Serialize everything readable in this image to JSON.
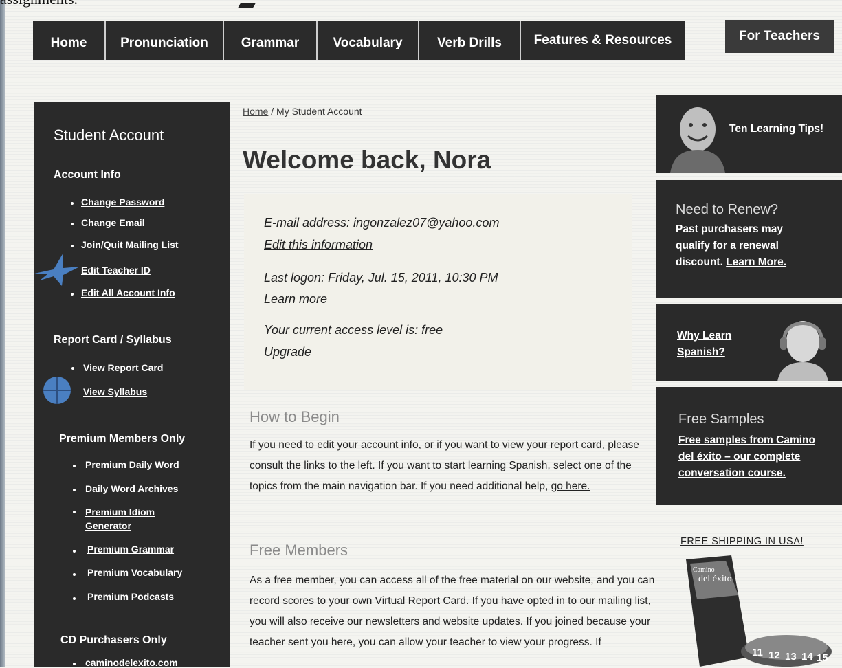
{
  "top_fragment": "assignments.",
  "nav": {
    "items": [
      "Home",
      "Pronunciation",
      "Grammar",
      "Vocabulary",
      "Verb Drills",
      "Features & Resources"
    ],
    "teachers": "For Teachers"
  },
  "sidebar": {
    "title": "Student Account",
    "account_info": {
      "heading": "Account Info",
      "links": [
        "Change Password",
        "Change Email",
        "Join/Quit Mailing List",
        "Edit Teacher ID",
        "Edit All Account Info"
      ]
    },
    "report_card": {
      "heading": "Report Card / Syllabus",
      "links": [
        "View Report Card",
        "View Syllabus"
      ]
    },
    "premium": {
      "heading": "Premium Members Only",
      "links": [
        "Premium Daily Word",
        "Daily Word Archives",
        "Premium Idiom Generator",
        "Premium Grammar",
        "Premium Vocabulary",
        "Premium Podcasts"
      ]
    },
    "cd": {
      "heading": "CD Purchasers Only",
      "links": [
        "caminodelexito.com"
      ]
    }
  },
  "breadcrumb": {
    "home": "Home",
    "separator": " / ",
    "current": "My Student Account"
  },
  "welcome": "Welcome back, Nora",
  "info": {
    "email": "E-mail address: ingonzalez07@yahoo.com",
    "edit": "Edit this information",
    "logon": "Last logon: Friday, Jul. 15, 2011, 10:30 PM",
    "learn_more": "Learn more",
    "access": "Your current access level is: free",
    "upgrade": "Upgrade"
  },
  "how_to_begin": {
    "heading": "How to Begin",
    "text": "If you need to edit your account info, or if you want to view your report card, please consult the links to the left. If you want to start learning Spanish, select one of the topics from the main navigation bar. If you need additional help, ",
    "link": "go here."
  },
  "free_members": {
    "heading": "Free Members",
    "text": "As a free member, you can access all of the free material on our website, and you can record scores to your own Virtual Report Card. If you have opted in to our mailing list, you will also receive our newsletters and website updates. If you joined because your teacher sent you here, you can allow your teacher to view your progress. If"
  },
  "right": {
    "tips": "Ten Learning Tips!",
    "renew_title": "Need to Renew?",
    "renew_text": "Past purchasers may qualify for a renewal discount. ",
    "renew_link": "Learn More.",
    "why": "Why Learn Spanish?",
    "samples_title": "Free Samples",
    "samples_link": "Free samples from Camino del éxito – our complete conversation course.",
    "shipping": "FREE SHIPPING IN USA!",
    "cd_label_1": "Camino",
    "cd_label_2": "del éxito",
    "cd_numbers": [
      "11",
      "12",
      "13",
      "14",
      "15"
    ]
  },
  "colors": {
    "dark_panel": "#2a2a2a",
    "annotation_blue": "#4a7fc1"
  }
}
